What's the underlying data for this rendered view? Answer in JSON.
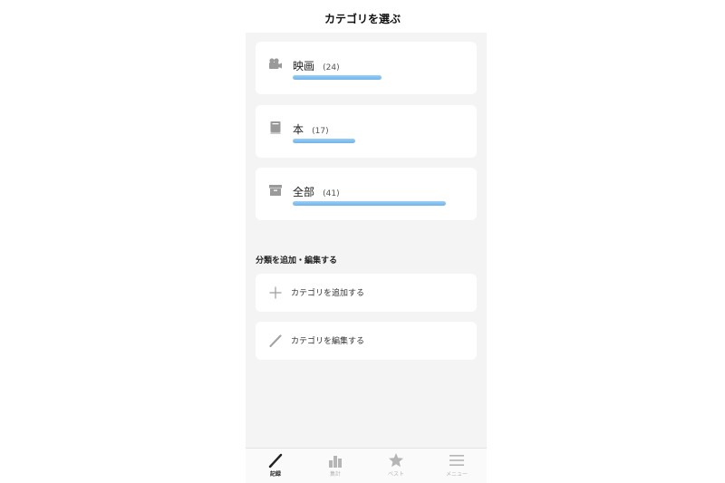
{
  "header": {
    "title": "カテゴリを選ぶ"
  },
  "categories": [
    {
      "name": "映画",
      "count": "(24)",
      "icon": "movie-camera-icon",
      "fill": 0.55
    },
    {
      "name": "本",
      "count": "(17)",
      "icon": "book-icon",
      "fill": 0.39
    },
    {
      "name": "全部",
      "count": "(41)",
      "icon": "archive-box-icon",
      "fill": 0.95
    }
  ],
  "section": {
    "title": "分類を追加・編集する"
  },
  "actions": {
    "add": {
      "label": "カテゴリを追加する",
      "icon": "plus-icon"
    },
    "edit": {
      "label": "カテゴリを編集する",
      "icon": "pencil-icon"
    }
  },
  "tabs": [
    {
      "label": "記録",
      "icon": "pencil-icon",
      "active": true
    },
    {
      "label": "集計",
      "icon": "bar-chart-icon",
      "active": false
    },
    {
      "label": "ベスト",
      "icon": "star-icon",
      "active": false
    },
    {
      "label": "メニュー",
      "icon": "menu-icon",
      "active": false
    }
  ],
  "colors": {
    "bar": "#7dbdee",
    "panel_bg": "#f4f4f4",
    "icon_gray": "#9a9a9a",
    "active_tab": "#222222",
    "inactive_tab": "#b5b5b5"
  }
}
